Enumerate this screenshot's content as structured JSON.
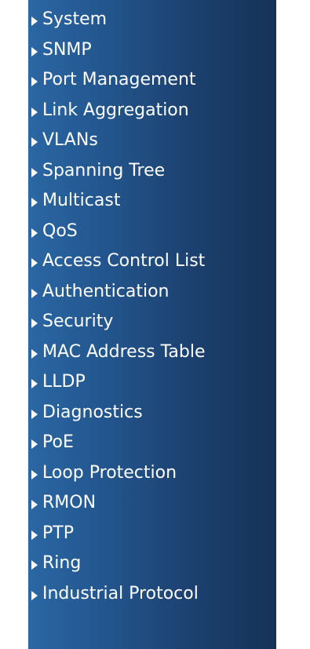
{
  "menu": {
    "items": [
      {
        "label": "System"
      },
      {
        "label": "SNMP"
      },
      {
        "label": "Port Management"
      },
      {
        "label": "Link Aggregation"
      },
      {
        "label": "VLANs"
      },
      {
        "label": "Spanning Tree"
      },
      {
        "label": "Multicast"
      },
      {
        "label": "QoS"
      },
      {
        "label": "Access Control List"
      },
      {
        "label": "Authentication"
      },
      {
        "label": "Security"
      },
      {
        "label": "MAC Address Table"
      },
      {
        "label": "LLDP"
      },
      {
        "label": "Diagnostics"
      },
      {
        "label": "PoE"
      },
      {
        "label": "Loop Protection"
      },
      {
        "label": "RMON"
      },
      {
        "label": "PTP"
      },
      {
        "label": "Ring"
      },
      {
        "label": "Industrial Protocol"
      }
    ],
    "icon": "triangle-right-icon",
    "colors": {
      "text": "#ffffff",
      "gradient_start": "#2a67a4",
      "gradient_end": "#153356"
    }
  }
}
